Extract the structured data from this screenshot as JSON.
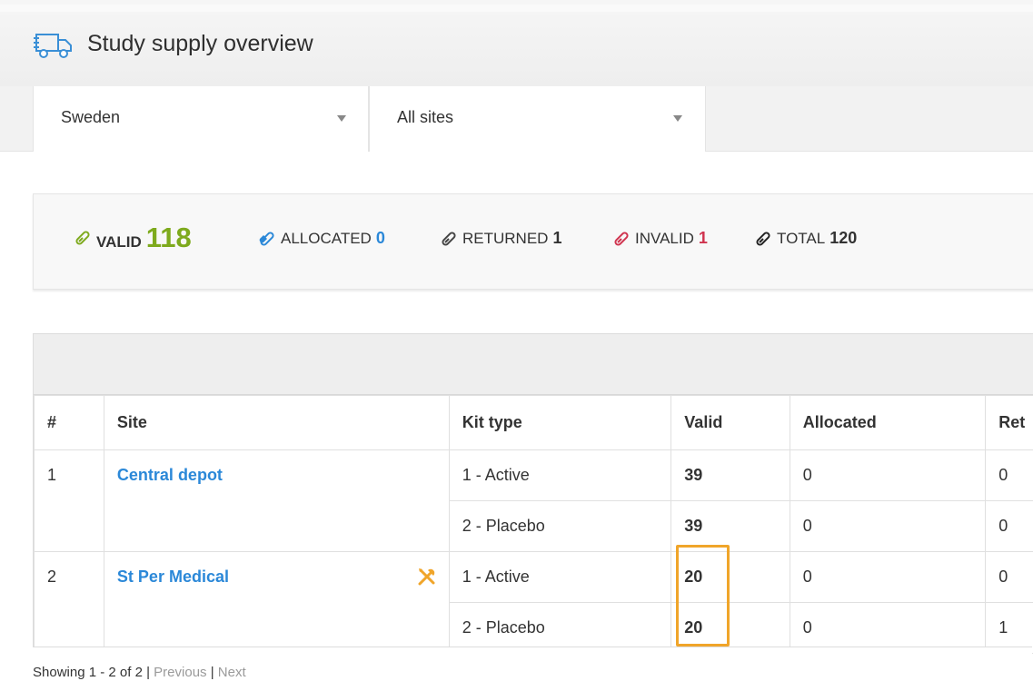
{
  "header": {
    "title": "Study supply overview",
    "icon": "truck-icon"
  },
  "filters": {
    "country": {
      "selected": "Sweden"
    },
    "site": {
      "selected": "All sites"
    }
  },
  "summary": {
    "valid": {
      "label": "VALID",
      "count": "118",
      "color": "#7eaa1d"
    },
    "allocated": {
      "label": "ALLOCATED",
      "count": "0",
      "color": "#2b88d8"
    },
    "returned": {
      "label": "RETURNED",
      "count": "1",
      "color": "#333333"
    },
    "invalid": {
      "label": "INVALID",
      "count": "1",
      "color": "#d0344f"
    },
    "total": {
      "label": "TOTAL",
      "count": "120",
      "color": "#333333"
    }
  },
  "table": {
    "columns": [
      "#",
      "Site",
      "Kit type",
      "Valid",
      "Allocated",
      "Ret"
    ],
    "rows": [
      {
        "num": "1",
        "site": "Central depot",
        "kits": [
          {
            "kit_type": "1 - Active",
            "valid": "39",
            "allocated": "0",
            "returned": "0"
          },
          {
            "kit_type": "2 - Placebo",
            "valid": "39",
            "allocated": "0",
            "returned": "0"
          }
        ]
      },
      {
        "num": "2",
        "site": "St Per Medical",
        "kits": [
          {
            "kit_type": "1 - Active",
            "valid": "20",
            "allocated": "0",
            "returned": "0"
          },
          {
            "kit_type": "2 - Placebo",
            "valid": "20",
            "allocated": "0",
            "returned": "1"
          }
        ]
      }
    ]
  },
  "pagination": {
    "showing": "Showing 1 - 2 of 2",
    "previous": "Previous",
    "next": "Next",
    "separator": "|"
  }
}
